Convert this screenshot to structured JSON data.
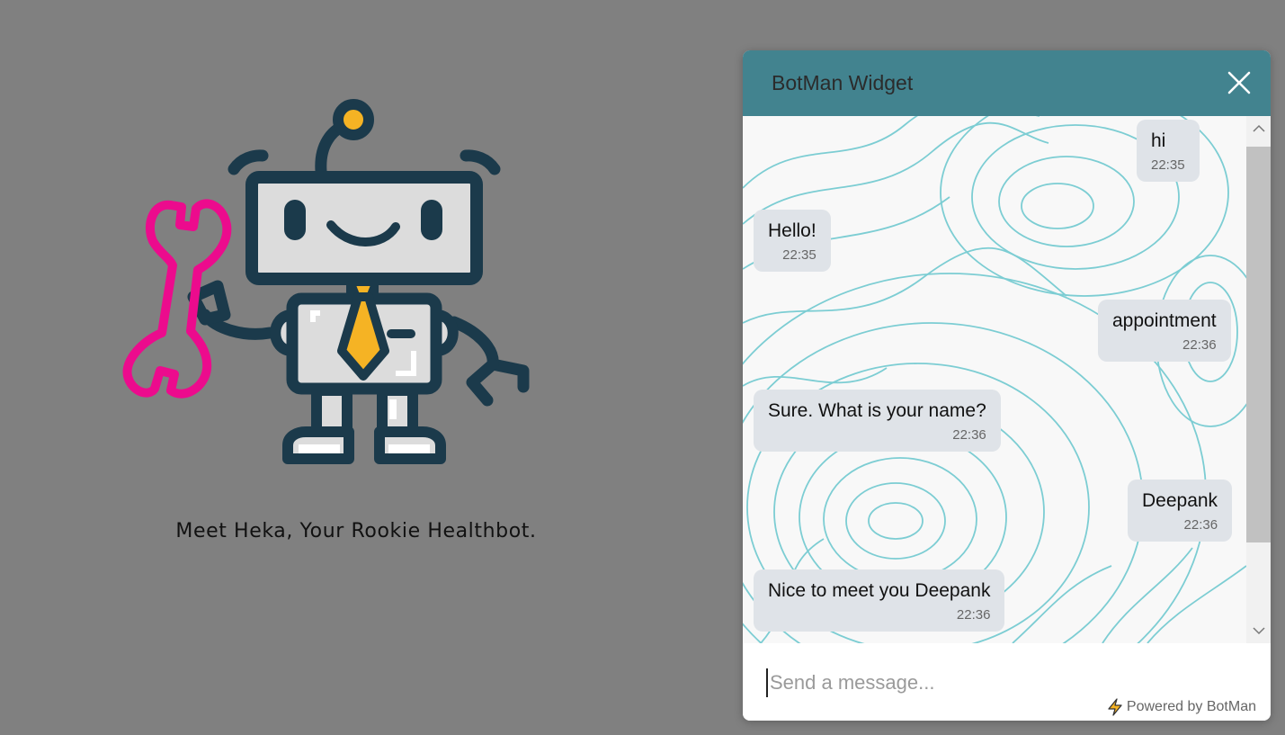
{
  "hero": {
    "tagline": "Meet Heka, Your Rookie Healthbot."
  },
  "widget": {
    "title": "BotMan Widget",
    "close_icon": "close-icon",
    "messages": [
      {
        "side": "user",
        "text": "hi",
        "time": "22:35"
      },
      {
        "side": "bot",
        "text": "Hello!",
        "time": "22:35"
      },
      {
        "side": "user",
        "text": "appointment",
        "time": "22:36"
      },
      {
        "side": "bot",
        "text": "Sure. What is your name?",
        "time": "22:36"
      },
      {
        "side": "user",
        "text": "Deepank",
        "time": "22:36"
      },
      {
        "side": "bot",
        "text": "Nice to meet you Deepank",
        "time": "22:36"
      }
    ],
    "input": {
      "placeholder": "Send a message...",
      "value": ""
    },
    "powered_by": "Powered by BotMan",
    "powered_icon": "lightning-icon"
  },
  "colors": {
    "page_bg": "#808080",
    "header": "#42838f",
    "bubble": "#dfe3e8",
    "topo_line": "#7ccdd3",
    "robot_dark": "#1b3a4b",
    "robot_tie": "#f5b324",
    "wrench": "#ec0b8d"
  }
}
